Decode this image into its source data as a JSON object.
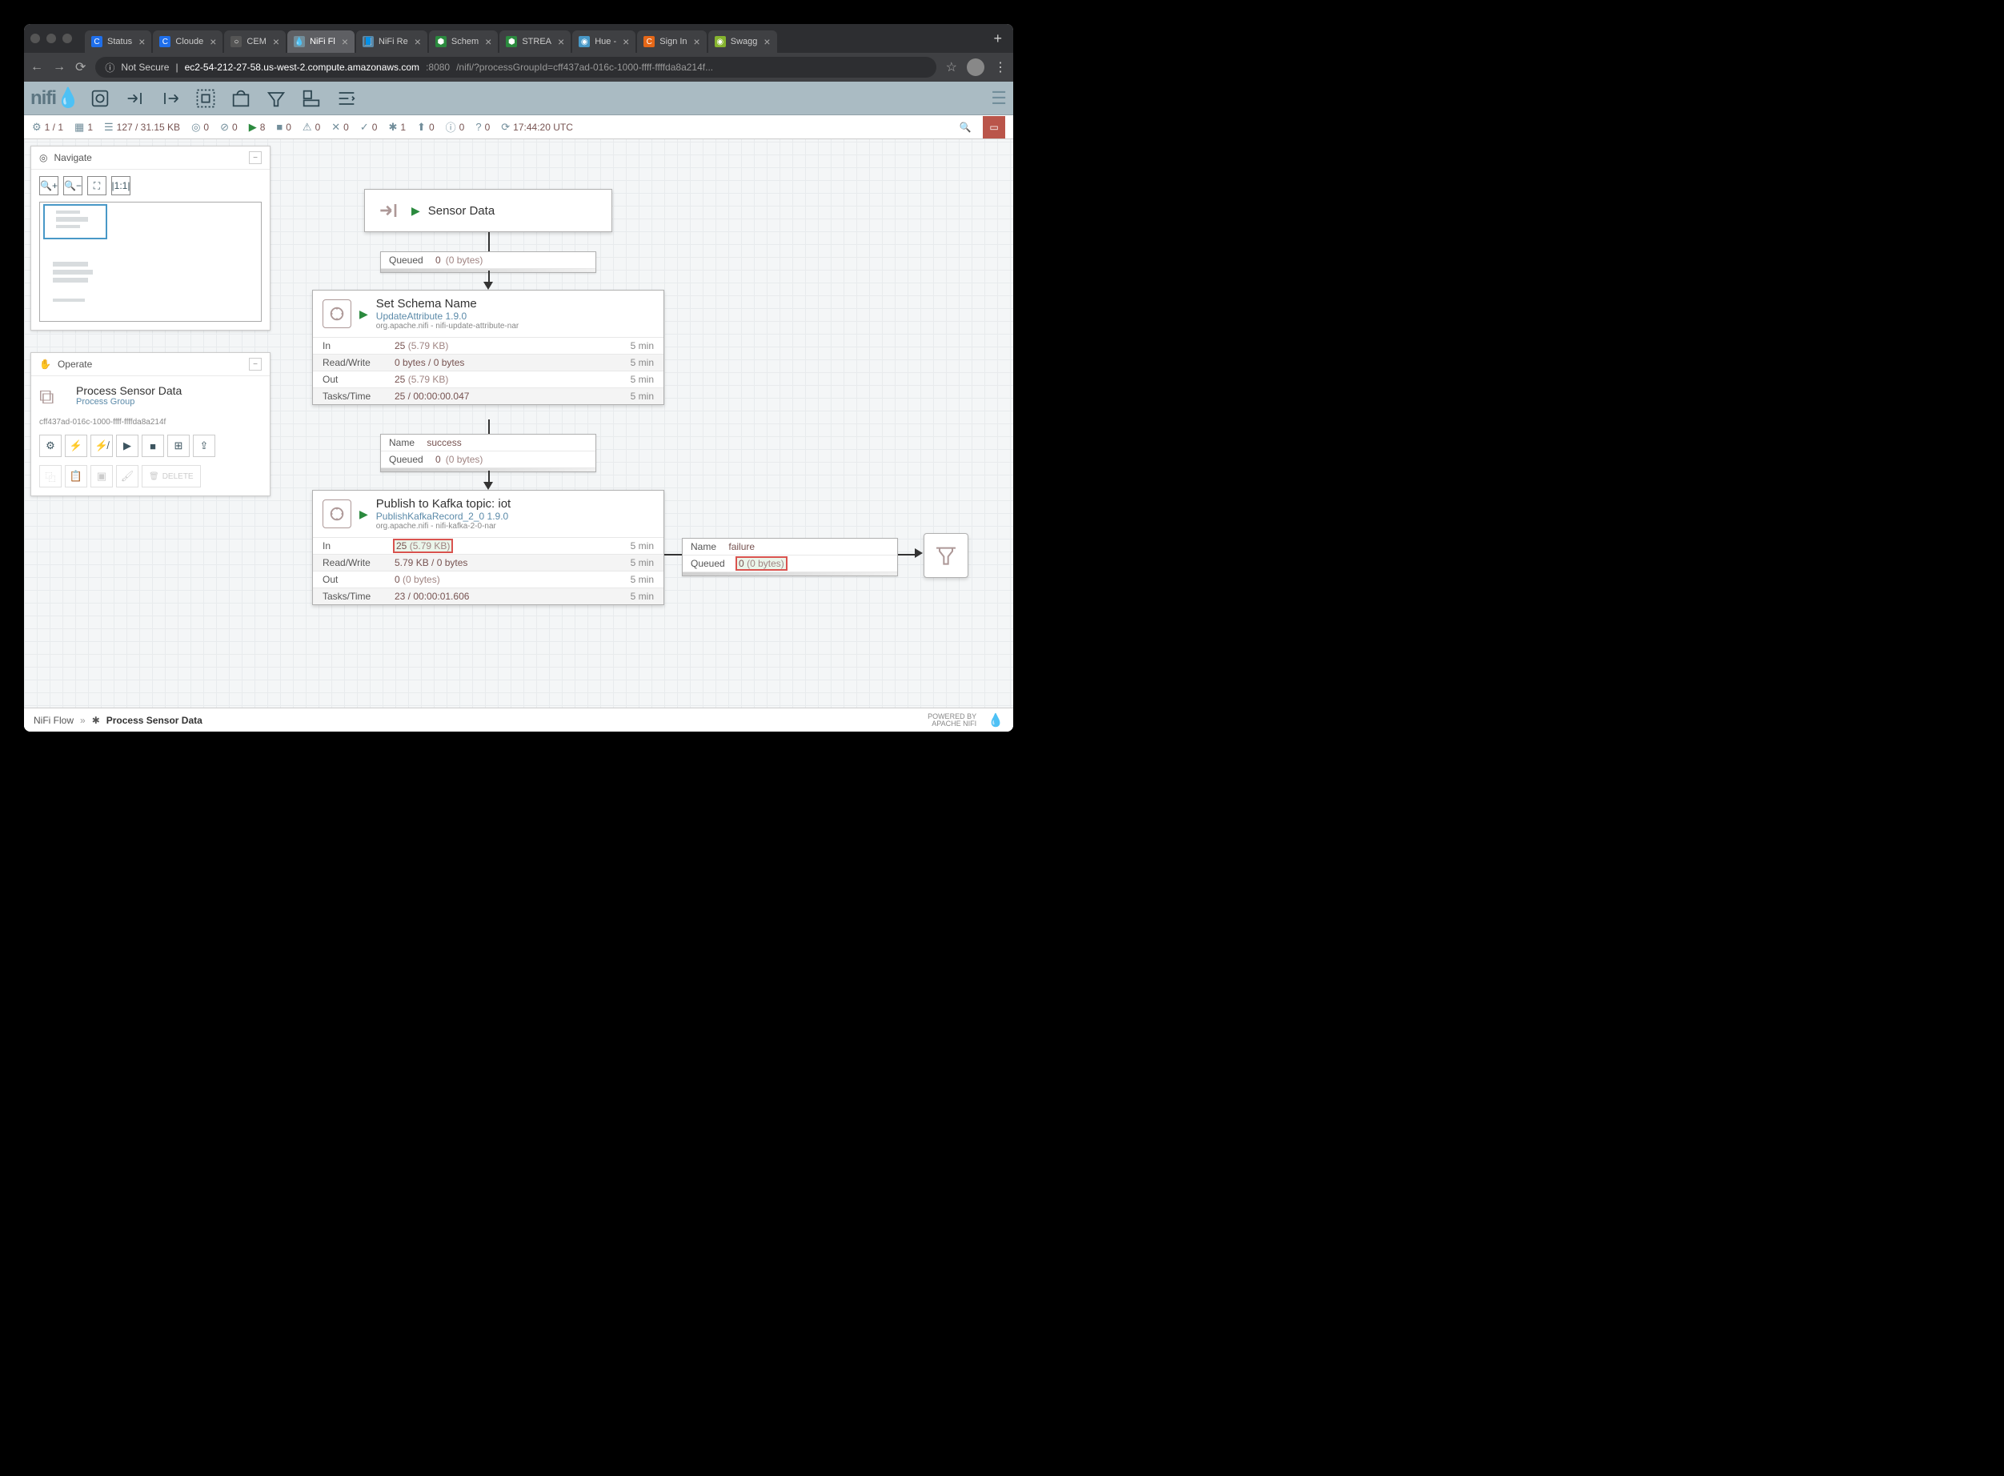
{
  "browser": {
    "tabs": [
      {
        "title": "Status",
        "fav": "C",
        "favbg": "#1f6feb"
      },
      {
        "title": "Cloude",
        "fav": "C",
        "favbg": "#1f6feb"
      },
      {
        "title": "CEM",
        "fav": "○",
        "favbg": "#555"
      },
      {
        "title": "NiFi Fl",
        "fav": "💧",
        "favbg": "#728e9b",
        "active": true
      },
      {
        "title": "NiFi Re",
        "fav": "📘",
        "favbg": "#5b8aa9"
      },
      {
        "title": "Schem",
        "fav": "⬢",
        "favbg": "#2b8a3e"
      },
      {
        "title": "STREA",
        "fav": "⬢",
        "favbg": "#2b8a3e"
      },
      {
        "title": "Hue - ",
        "fav": "◉",
        "favbg": "#4898c7"
      },
      {
        "title": "Sign In",
        "fav": "C",
        "favbg": "#e56717"
      },
      {
        "title": "Swagg",
        "fav": "◉",
        "favbg": "#85b32e"
      }
    ],
    "url": {
      "warn": "Not Secure",
      "host": "ec2-54-212-27-58.us-west-2.compute.amazonaws.com",
      "port": ":8080",
      "path": "/nifi/?processGroupId=cff437ad-016c-1000-ffff-ffffda8a214f..."
    }
  },
  "logo": "nifi",
  "status": {
    "nodes": "1 / 1",
    "threads": "1",
    "queued": "127 / 31.15 KB",
    "transmitting": "0",
    "not_transmitting": "0",
    "running": "8",
    "stopped": "0",
    "invalid": "0",
    "disabled": "0",
    "up_to_date": "0",
    "locally_modified": "1",
    "stale": "0",
    "locally_stale": "0",
    "sync_failure": "0",
    "refresh": "17:44:20 UTC"
  },
  "navigate": {
    "title": "Navigate"
  },
  "operate": {
    "title": "Operate",
    "name": "Process Sensor Data",
    "type": "Process Group",
    "id": "cff437ad-016c-1000-ffff-ffffda8a214f",
    "delete": "DELETE"
  },
  "input_port": {
    "name": "Sensor Data"
  },
  "conn1": {
    "queued_label": "Queued",
    "count": "0",
    "size": "(0 bytes)"
  },
  "proc1": {
    "name": "Set Schema Name",
    "type": "UpdateAttribute 1.9.0",
    "bundle": "org.apache.nifi - nifi-update-attribute-nar",
    "in_label": "In",
    "in_val": "25",
    "in_size": "(5.79 KB)",
    "in_time": "5 min",
    "rw_label": "Read/Write",
    "rw_val": "0 bytes / 0 bytes",
    "rw_time": "5 min",
    "out_label": "Out",
    "out_val": "25",
    "out_size": "(5.79 KB)",
    "out_time": "5 min",
    "tt_label": "Tasks/Time",
    "tt_val": "25 / 00:00:00.047",
    "tt_time": "5 min"
  },
  "conn2": {
    "name_label": "Name",
    "name": "success",
    "queued_label": "Queued",
    "count": "0",
    "size": "(0 bytes)"
  },
  "proc2": {
    "name": "Publish to Kafka topic: iot",
    "type": "PublishKafkaRecord_2_0 1.9.0",
    "bundle": "org.apache.nifi - nifi-kafka-2-0-nar",
    "in_label": "In",
    "in_val": "25",
    "in_size": "(5.79 KB)",
    "in_time": "5 min",
    "rw_label": "Read/Write",
    "rw_val": "5.79 KB / 0 bytes",
    "rw_time": "5 min",
    "out_label": "Out",
    "out_val": "0",
    "out_size": "(0 bytes)",
    "out_time": "5 min",
    "tt_label": "Tasks/Time",
    "tt_val": "23 / 00:00:01.606",
    "tt_time": "5 min"
  },
  "conn3": {
    "name_label": "Name",
    "name": "failure",
    "queued_label": "Queued",
    "count": "0",
    "size": "(0 bytes)"
  },
  "breadcrumb": {
    "root": "NiFi Flow",
    "current": "Process Sensor Data",
    "powered1": "POWERED BY",
    "powered2": "APACHE NIFI"
  }
}
